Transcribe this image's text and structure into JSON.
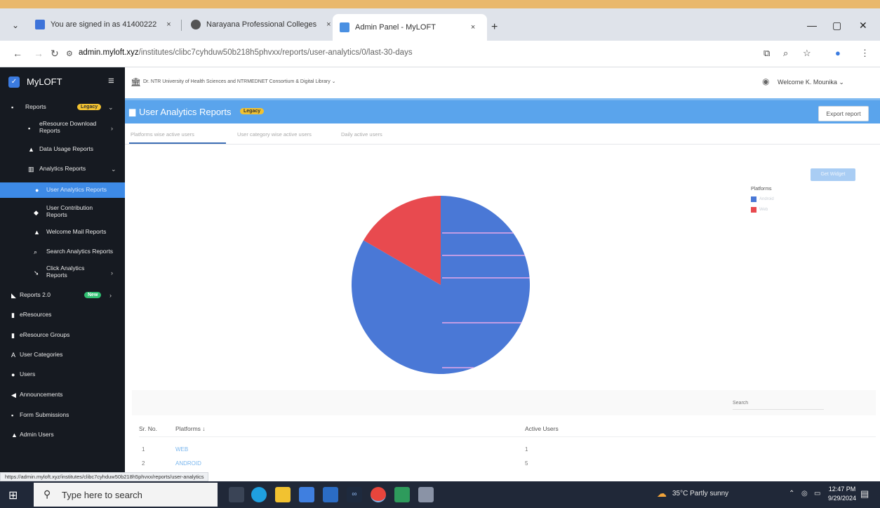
{
  "browser": {
    "tabs": [
      {
        "title": "You are signed in as 41400222"
      },
      {
        "title": "Narayana Professional Colleges"
      },
      {
        "title": "Admin Panel - MyLOFT"
      }
    ],
    "close_glyph": "×",
    "new_tab_glyph": "+",
    "url_host": "admin.myloft.xyz",
    "url_path": "/institutes/clibc7cyhduw50b218h5phvxx/reports/user-analytics/0/last-30-days",
    "status_url": "https://admin.myloft.xyz/institutes/clibc7cyhduw50b218h5phvxx/reports/user-analytics"
  },
  "sidebar": {
    "brand": "MyLOFT",
    "items": [
      {
        "label": "Reports",
        "badge": "Legacy"
      },
      {
        "label": "eResource Download Reports"
      },
      {
        "label": "Data Usage Reports"
      },
      {
        "label": "Analytics Reports"
      },
      {
        "label": "User Analytics Reports"
      },
      {
        "label": "User Contribution Reports"
      },
      {
        "label": "Welcome Mail Reports"
      },
      {
        "label": "Search Analytics Reports"
      },
      {
        "label": "Click Analytics Reports"
      },
      {
        "label": "Reports 2.0",
        "badge": "New"
      },
      {
        "label": "eResources"
      },
      {
        "label": "eResource Groups"
      },
      {
        "label": "User Categories"
      },
      {
        "label": "Users"
      },
      {
        "label": "Announcements"
      },
      {
        "label": "Form Submissions"
      },
      {
        "label": "Admin Users"
      }
    ]
  },
  "header": {
    "institution": "Dr. NTR University of Health Sciences and NTRMEDNET Consortium & Digital Library",
    "welcome": "Welcome K. Mounika",
    "page_title": "User Analytics Reports",
    "badge": "Legacy",
    "export_label": "Export report"
  },
  "subtabs": [
    "Platforms wise active users",
    "User category wise active users",
    "Daily active users"
  ],
  "get_button": "Get Widget",
  "search_placeholder": "Search",
  "colors": {
    "android": "#4a78d6",
    "web": "#e84a4f"
  },
  "chart_data": {
    "type": "pie",
    "title": "",
    "legend_title": "Platforms",
    "legend_position": "top-right",
    "slices": [
      {
        "name": "Android",
        "value": 5
      },
      {
        "name": "Web",
        "value": 1
      }
    ]
  },
  "table": {
    "headers": [
      "Sr. No.",
      "Platforms ↓",
      "Active Users"
    ],
    "rows": [
      {
        "sr": "1",
        "platform": "WEB",
        "users": "1"
      },
      {
        "sr": "2",
        "platform": "ANDROID",
        "users": "5"
      }
    ]
  },
  "taskbar": {
    "search_text": "Type here to search",
    "weather": "35°C  Partly sunny",
    "time": "12:47 PM",
    "date": "9/29/2024"
  }
}
